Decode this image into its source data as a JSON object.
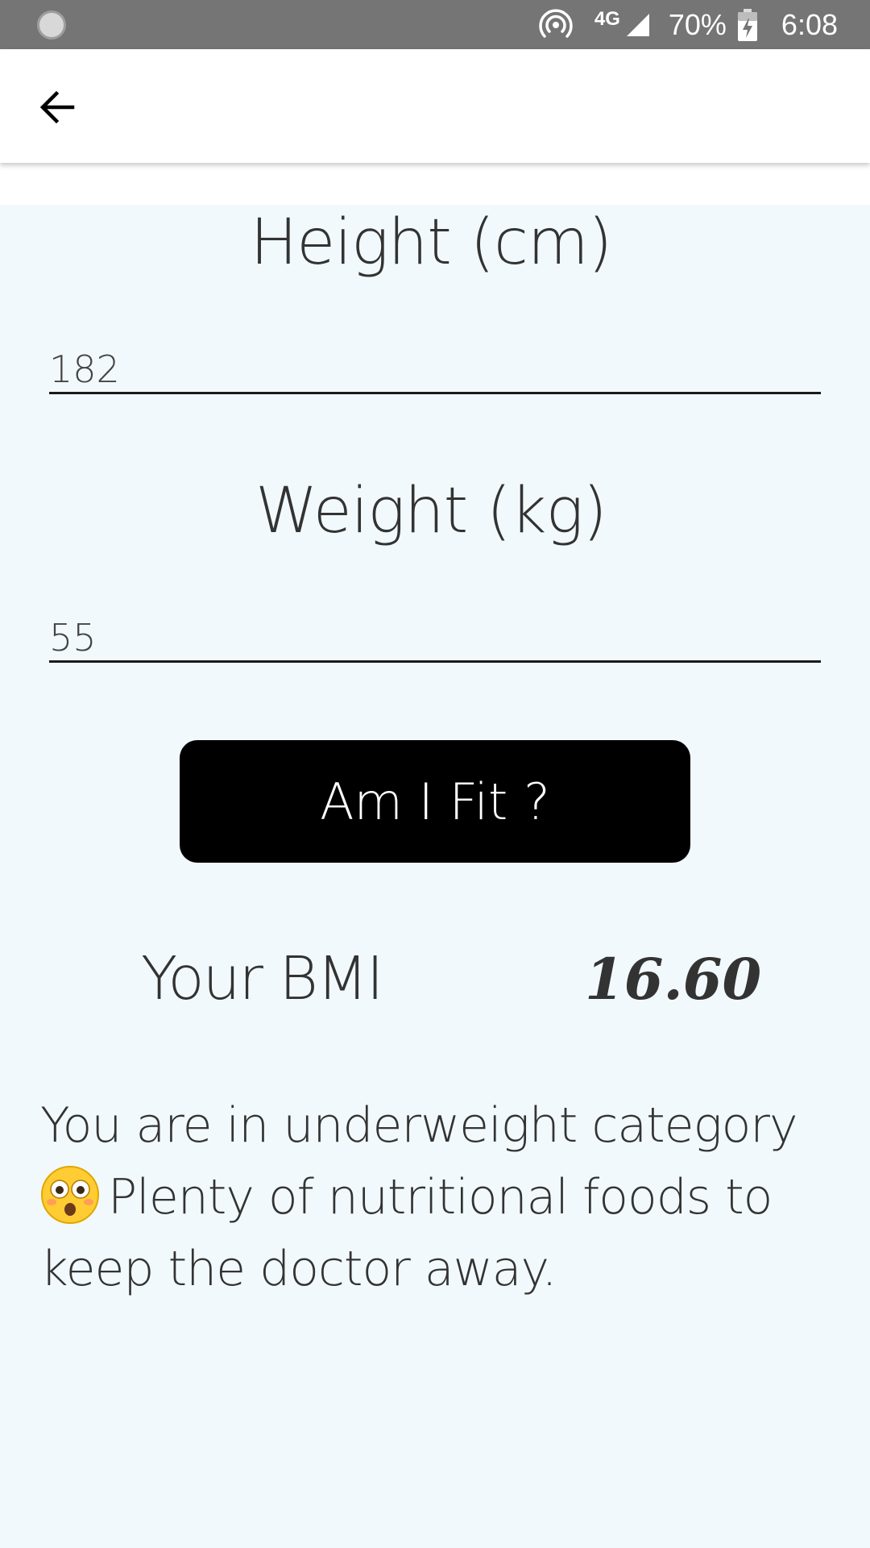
{
  "status_bar": {
    "network": "4G",
    "battery": "70%",
    "time": "6:08"
  },
  "app_bar": {
    "back_icon": "arrow-left-icon"
  },
  "form": {
    "height_label": "Height (cm)",
    "height_value": "182",
    "weight_label": "Weight (kg)",
    "weight_value": "55",
    "submit_label": "Am I Fit ?"
  },
  "result": {
    "bmi_label": "Your BMI",
    "bmi_value": "16.60",
    "message_part1": "You are in underweight category",
    "emoji_icon": "flushed-face-icon",
    "message_part2": "Plenty of nutritional foods to keep the doctor away."
  },
  "colors": {
    "status_bar": "#757575",
    "background": "#f2f9fc",
    "button": "#000000",
    "text": "#333333"
  }
}
